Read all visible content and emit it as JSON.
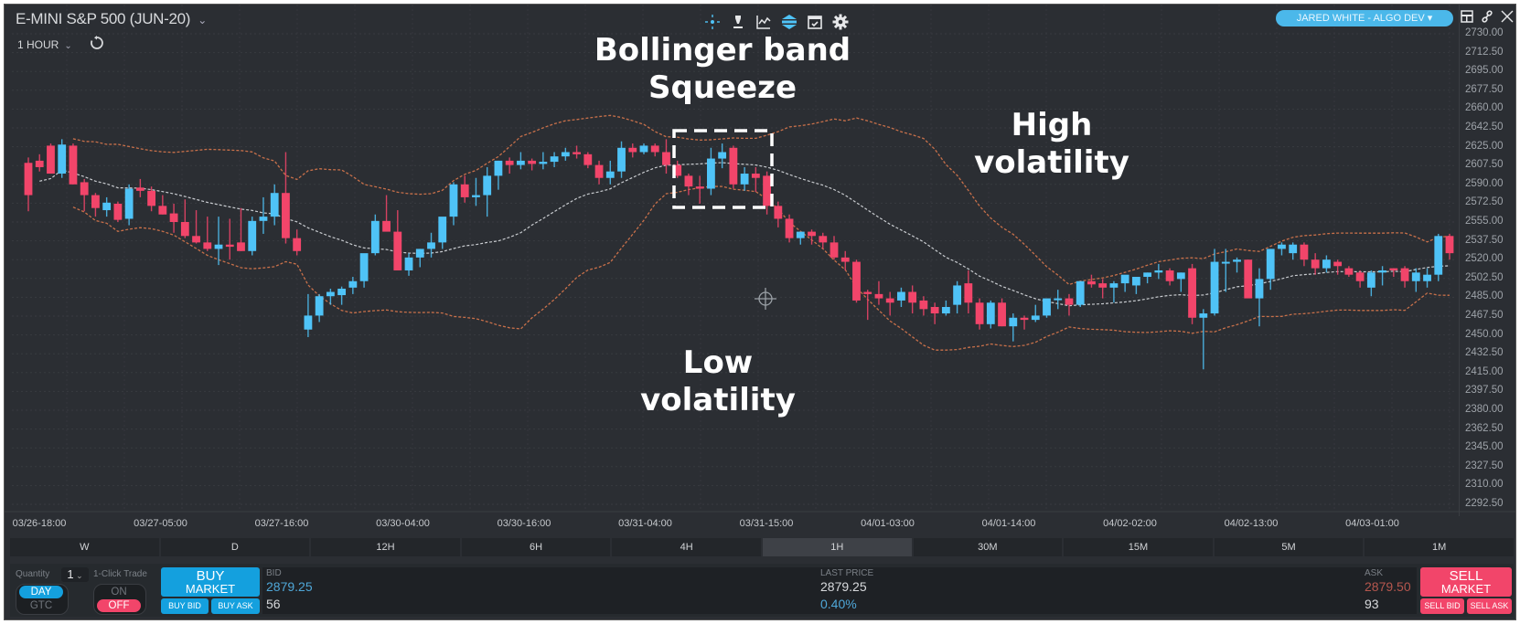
{
  "header": {
    "instrument_title": "E-MINI S&P 500 (JUN-20)",
    "interval_label": "1 HOUR",
    "user_pill": "JARED WHITE - ALGO DEV ▾",
    "toolbar_icons": [
      "crosshair-icon",
      "pen-tool-icon",
      "line-chart-icon",
      "layers-icon",
      "calendar-check-icon",
      "gear-icon"
    ],
    "window_icons": [
      "layout-icon",
      "link-icon",
      "close-icon"
    ]
  },
  "timeframes": [
    {
      "label": "W",
      "active": false
    },
    {
      "label": "D",
      "active": false
    },
    {
      "label": "12H",
      "active": false
    },
    {
      "label": "6H",
      "active": false
    },
    {
      "label": "4H",
      "active": false
    },
    {
      "label": "1H",
      "active": true
    },
    {
      "label": "30M",
      "active": false
    },
    {
      "label": "15M",
      "active": false
    },
    {
      "label": "5M",
      "active": false
    },
    {
      "label": "1M",
      "active": false
    }
  ],
  "trade_panel": {
    "quantity_label": "Quantity",
    "quantity_value": "1",
    "one_click_label": "1-Click Trade",
    "day_label": "DAY",
    "gtc_label": "GTC",
    "on_label": "ON",
    "off_label": "OFF",
    "buy_market_line1": "BUY",
    "buy_market_line2": "MARKET",
    "buy_bid_label": "BUY BID",
    "buy_ask_label": "BUY ASK",
    "bid_label": "BID",
    "bid_price": "2879.25",
    "bid_size": "56",
    "last_price_label": "LAST PRICE",
    "last_price": "2879.25",
    "change_pct": "0.40%",
    "ask_label": "ASK",
    "ask_price": "2879.50",
    "ask_size": "93",
    "sell_market_line1": "SELL",
    "sell_market_line2": "MARKET",
    "sell_bid_label": "SELL BID",
    "sell_ask_label": "SELL ASK"
  },
  "colors": {
    "bull": "#4fc3f7",
    "bear": "#f2456a",
    "band": "#c8704a",
    "middle": "#c9ccd0",
    "background": "#2b2e33",
    "accent_blue": "#14a0de",
    "accent_red": "#f2456a"
  },
  "chart_data": {
    "type": "candlestick",
    "title": "E-MINI S&P 500 (JUN-20)",
    "interval": "1 HOUR",
    "indicator": "Bollinger Bands",
    "ylim": [
      2292.5,
      2730.0
    ],
    "y_ticks": [
      "2730.00",
      "2712.50",
      "2695.00",
      "2677.50",
      "2660.00",
      "2642.50",
      "2625.00",
      "2607.50",
      "2590.00",
      "2572.50",
      "2555.00",
      "2537.50",
      "2520.00",
      "2502.50",
      "2485.00",
      "2467.50",
      "2450.00",
      "2432.50",
      "2415.00",
      "2397.50",
      "2380.00",
      "2362.50",
      "2345.00",
      "2327.50",
      "2310.00",
      "2292.50"
    ],
    "x_ticks": [
      "03/26-18:00",
      "03/27-05:00",
      "03/27-16:00",
      "03/30-04:00",
      "03/30-16:00",
      "03/31-04:00",
      "03/31-15:00",
      "04/01-03:00",
      "04/01-14:00",
      "04/02-02:00",
      "04/02-13:00",
      "04/03-01:00"
    ],
    "annotations": [
      {
        "text": "Bollinger band Squeeze",
        "location": "top-center"
      },
      {
        "text": "High volatility",
        "location": "upper-right"
      },
      {
        "text": "Low volatility",
        "location": "lower-center"
      }
    ],
    "candles": [
      [
        2610,
        2615,
        2565,
        2580
      ],
      [
        2612,
        2618,
        2602,
        2606
      ],
      [
        2626,
        2628,
        2600,
        2600
      ],
      [
        2600,
        2632,
        2596,
        2627
      ],
      [
        2626,
        2628,
        2590,
        2590
      ],
      [
        2592,
        2595,
        2565,
        2580
      ],
      [
        2580,
        2582,
        2560,
        2568
      ],
      [
        2566,
        2578,
        2560,
        2573
      ],
      [
        2572,
        2574,
        2555,
        2557
      ],
      [
        2558,
        2590,
        2552,
        2586
      ],
      [
        2587,
        2595,
        2578,
        2584
      ],
      [
        2584,
        2588,
        2565,
        2570
      ],
      [
        2570,
        2580,
        2562,
        2562
      ],
      [
        2563,
        2572,
        2545,
        2555
      ],
      [
        2555,
        2576,
        2540,
        2542
      ],
      [
        2542,
        2566,
        2535,
        2536
      ],
      [
        2536,
        2560,
        2528,
        2530
      ],
      [
        2530,
        2560,
        2515,
        2534
      ],
      [
        2534,
        2558,
        2520,
        2532
      ],
      [
        2536,
        2568,
        2528,
        2528
      ],
      [
        2528,
        2560,
        2524,
        2556
      ],
      [
        2556,
        2578,
        2544,
        2560
      ],
      [
        2560,
        2590,
        2552,
        2582
      ],
      [
        2582,
        2620,
        2535,
        2540
      ],
      [
        2540,
        2548,
        2524,
        2528
      ],
      [
        2455,
        2488,
        2448,
        2468
      ],
      [
        2468,
        2488,
        2462,
        2486
      ],
      [
        2486,
        2493,
        2478,
        2490
      ],
      [
        2487,
        2495,
        2478,
        2493
      ],
      [
        2494,
        2504,
        2488,
        2500
      ],
      [
        2500,
        2518,
        2494,
        2526
      ],
      [
        2526,
        2562,
        2524,
        2556
      ],
      [
        2556,
        2580,
        2550,
        2546
      ],
      [
        2546,
        2566,
        2520,
        2510
      ],
      [
        2510,
        2526,
        2505,
        2522
      ],
      [
        2522,
        2530,
        2513,
        2530
      ],
      [
        2530,
        2545,
        2522,
        2536
      ],
      [
        2536,
        2556,
        2530,
        2560
      ],
      [
        2560,
        2592,
        2552,
        2590
      ],
      [
        2590,
        2598,
        2573,
        2578
      ],
      [
        2578,
        2596,
        2570,
        2580
      ],
      [
        2580,
        2606,
        2560,
        2598
      ],
      [
        2598,
        2612,
        2585,
        2612
      ],
      [
        2612,
        2615,
        2600,
        2608
      ],
      [
        2608,
        2620,
        2604,
        2612
      ],
      [
        2612,
        2614,
        2603,
        2609
      ],
      [
        2609,
        2620,
        2604,
        2611
      ],
      [
        2611,
        2620,
        2606,
        2616
      ],
      [
        2616,
        2624,
        2612,
        2620
      ],
      [
        2620,
        2626,
        2614,
        2618
      ],
      [
        2618,
        2620,
        2605,
        2608
      ],
      [
        2608,
        2612,
        2590,
        2596
      ],
      [
        2596,
        2612,
        2590,
        2602
      ],
      [
        2602,
        2630,
        2596,
        2624
      ],
      [
        2624,
        2628,
        2615,
        2620
      ],
      [
        2620,
        2628,
        2618,
        2626
      ],
      [
        2626,
        2628,
        2616,
        2620
      ],
      [
        2620,
        2632,
        2600,
        2608
      ],
      [
        2608,
        2612,
        2596,
        2598
      ],
      [
        2598,
        2600,
        2580,
        2588
      ],
      [
        2588,
        2598,
        2572,
        2586
      ],
      [
        2586,
        2624,
        2580,
        2614
      ],
      [
        2614,
        2628,
        2605,
        2620
      ],
      [
        2624,
        2626,
        2586,
        2590
      ],
      [
        2590,
        2606,
        2584,
        2600
      ],
      [
        2600,
        2606,
        2583,
        2596
      ],
      [
        2598,
        2602,
        2562,
        2570
      ],
      [
        2570,
        2574,
        2550,
        2558
      ],
      [
        2558,
        2562,
        2536,
        2540
      ],
      [
        2540,
        2545,
        2534,
        2546
      ],
      [
        2546,
        2548,
        2534,
        2542
      ],
      [
        2542,
        2545,
        2530,
        2536
      ],
      [
        2536,
        2542,
        2520,
        2522
      ],
      [
        2522,
        2528,
        2510,
        2518
      ],
      [
        2518,
        2520,
        2480,
        2482
      ],
      [
        2490,
        2492,
        2464,
        2488
      ],
      [
        2488,
        2500,
        2478,
        2484
      ],
      [
        2484,
        2490,
        2468,
        2480
      ],
      [
        2482,
        2494,
        2476,
        2490
      ],
      [
        2490,
        2496,
        2470,
        2480
      ],
      [
        2482,
        2486,
        2468,
        2474
      ],
      [
        2476,
        2480,
        2460,
        2470
      ],
      [
        2470,
        2482,
        2468,
        2476
      ],
      [
        2478,
        2500,
        2470,
        2496
      ],
      [
        2498,
        2510,
        2470,
        2480
      ],
      [
        2480,
        2484,
        2455,
        2460
      ],
      [
        2460,
        2482,
        2456,
        2480
      ],
      [
        2480,
        2484,
        2458,
        2458
      ],
      [
        2458,
        2470,
        2444,
        2466
      ],
      [
        2466,
        2468,
        2455,
        2464
      ],
      [
        2464,
        2478,
        2462,
        2468
      ],
      [
        2468,
        2480,
        2466,
        2484
      ],
      [
        2484,
        2492,
        2474,
        2484
      ],
      [
        2484,
        2488,
        2468,
        2478
      ],
      [
        2478,
        2500,
        2476,
        2500
      ],
      [
        2500,
        2506,
        2494,
        2497
      ],
      [
        2498,
        2502,
        2484,
        2494
      ],
      [
        2494,
        2500,
        2480,
        2498
      ],
      [
        2498,
        2504,
        2490,
        2506
      ],
      [
        2496,
        2502,
        2488,
        2504
      ],
      [
        2504,
        2508,
        2498,
        2508
      ],
      [
        2508,
        2516,
        2502,
        2510
      ],
      [
        2510,
        2512,
        2496,
        2500
      ],
      [
        2502,
        2508,
        2490,
        2508
      ],
      [
        2512,
        2516,
        2460,
        2466
      ],
      [
        2466,
        2474,
        2418,
        2470
      ],
      [
        2470,
        2530,
        2468,
        2518
      ],
      [
        2518,
        2530,
        2490,
        2518
      ],
      [
        2518,
        2522,
        2508,
        2520
      ],
      [
        2520,
        2520,
        2494,
        2484
      ],
      [
        2484,
        2512,
        2458,
        2502
      ],
      [
        2502,
        2530,
        2492,
        2530
      ],
      [
        2530,
        2536,
        2524,
        2534
      ],
      [
        2526,
        2536,
        2520,
        2534
      ],
      [
        2534,
        2536,
        2514,
        2520
      ],
      [
        2520,
        2526,
        2506,
        2512
      ],
      [
        2512,
        2524,
        2508,
        2520
      ],
      [
        2518,
        2520,
        2506,
        2514
      ],
      [
        2512,
        2514,
        2504,
        2506
      ],
      [
        2508,
        2510,
        2494,
        2500
      ],
      [
        2494,
        2510,
        2486,
        2508
      ],
      [
        2508,
        2514,
        2496,
        2510
      ],
      [
        2512,
        2512,
        2504,
        2510
      ],
      [
        2512,
        2514,
        2494,
        2500
      ],
      [
        2500,
        2512,
        2490,
        2508
      ],
      [
        2500,
        2512,
        2494,
        2506
      ],
      [
        2506,
        2544,
        2500,
        2542
      ],
      [
        2542,
        2544,
        2520,
        2526
      ]
    ],
    "bands_note": "Upper, middle (20-period SMA) and lower Bollinger bands drawn from the same candles"
  }
}
